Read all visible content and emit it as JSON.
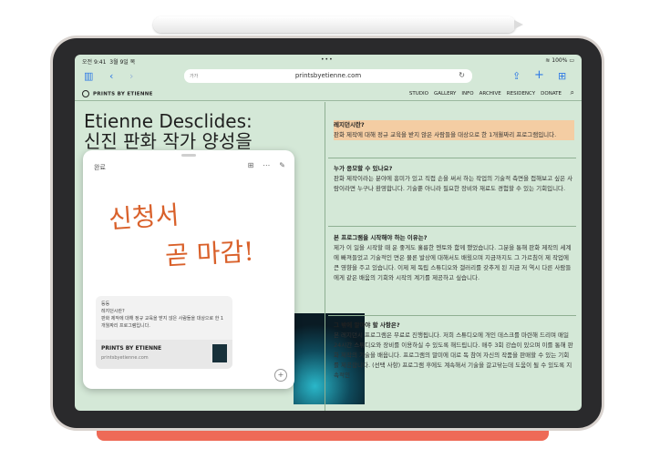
{
  "status": {
    "time": "오전 9:41",
    "date": "3월 9일 목",
    "battery": "100%"
  },
  "browser": {
    "tabs_label": "가가",
    "url": "printsbyetienne.com",
    "icons": [
      "sidebar-icon",
      "back-icon",
      "forward-icon",
      "reload-icon",
      "share-icon",
      "new-tab-icon",
      "tab-overview-icon"
    ]
  },
  "site": {
    "brand": "PRINTS BY ETIENNE",
    "nav": [
      "STUDIO",
      "GALLERY",
      "INFO",
      "ARCHIVE",
      "RESIDENCY",
      "DONATE"
    ],
    "hero_title": "Etienne Desclides:",
    "hero_sub": "신진 판화 작가 양성을"
  },
  "faq": [
    {
      "q": "레지던시란?",
      "a": "판화 제작에 대해 정규 교육을 받지 않은 사람들을 대상으로 한 1개월짜리 프로그램입니다."
    },
    {
      "q": "누가 응모할 수 있나요?",
      "a": "판화 제작이라는 분야에 흥미가 있고 직접 손을 써서 하는 작업의 기술적 측면을 접해보고 싶은 사람이라면 누구나 환영합니다. 기술뿐 아니라 필요한 장비와 재료도 경험할 수 있는 기회입니다."
    },
    {
      "q": "본 프로그램을 시작해야 하는 이유는?",
      "a": "제가 이 일을 시작할 때 운 좋게도 훌륭한 멘토와 함께 했었습니다. 그분을 통해 판화 제작의 세계에 빠져들었고 기술적인 면은 물론 발상에 대해서도 배웠으며 지금까지도 그 가르침이 제 작업에 큰 영향을 주고 있습니다. 이제 제 독립 스튜디오와 갤러리를 갖추게 된 지금 저 역시 다른 사람들에게 같은 배움의 기회와 시작의 계기를 제공하고 싶습니다."
    },
    {
      "q": "그 밖에 알아야 할 사항은?",
      "a": "본 레지던시 프로그램은 무료로 진행됩니다. 저희 스튜디오에 개인 데스크를 마련해 드리며 매일 24시간 스튜디오와 장비를 이용하실 수 있도록 해드립니다. 매주 3회 강습이 있으며 이를 통해 판화 제작의 기술을 배웁니다. 프로그램의 말미에 대로 독 참여 자신의 작품을 판매할 수 있는 기회를 제공합니다. (선택 사항) 프로그램 후에도 계속해서 기술을 갈고닦는데 도움이 될 수 있도록 지속적인"
    }
  ],
  "note": {
    "done_label": "완료",
    "handwriting_line1": "신청서",
    "handwriting_line2": "곧 마감!",
    "card_title": "등등",
    "card_q": "레지던시란?",
    "card_body": "판화 제작에 대해 정규 교육을 받지 않은 사람들을 대상으로 한 1개월짜리 프로그램입니다.",
    "card_site": "PRINTS BY ETIENNE",
    "card_domain": "printsbyetienne.com"
  }
}
